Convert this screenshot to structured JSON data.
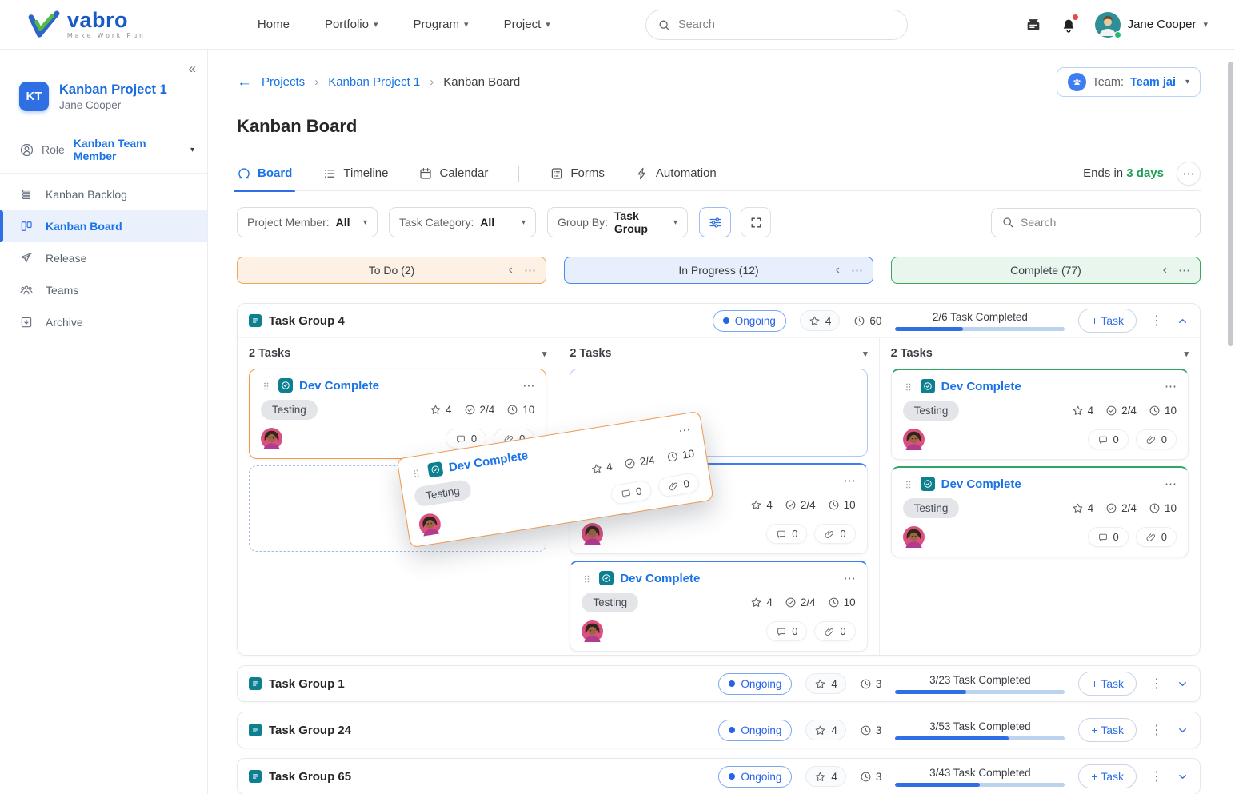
{
  "colors": {
    "primary_blue": "#2F6FE4",
    "link_blue": "#1A73E8",
    "success_green": "#1E9E57",
    "todo_accent": "#EDA85C",
    "inprogress_accent": "#4E86F0",
    "complete_accent": "#3BA55D",
    "notification_red": "#E5484D",
    "task_badge_teal": "#0C7F90"
  },
  "icons": {
    "collapse-sidebar": "«",
    "more-horizontal": "⋯",
    "more-vertical": "⋮",
    "collapse-column": "‹",
    "caret-down": "▾",
    "back-arrow": "←",
    "chevron-right": "›",
    "plus": "+"
  },
  "topbar": {
    "logo_text": "vabro",
    "logo_tagline": "Make Work Fun",
    "nav": [
      {
        "label": "Home"
      },
      {
        "label": "Portfolio"
      },
      {
        "label": "Program"
      },
      {
        "label": "Project"
      }
    ],
    "search_placeholder": "Search",
    "user_name": "Jane Cooper"
  },
  "sidebar": {
    "project": {
      "initials": "KT",
      "name": "Kanban Project 1",
      "owner": "Jane Cooper"
    },
    "role_label": "Role",
    "role_value": "Kanban Team Member",
    "items": [
      {
        "label": "Kanban Backlog"
      },
      {
        "label": "Kanban Board"
      },
      {
        "label": "Release"
      },
      {
        "label": "Teams"
      },
      {
        "label": "Archive"
      }
    ]
  },
  "breadcrumb": {
    "items": [
      {
        "label": "Projects"
      },
      {
        "label": "Kanban Project 1"
      },
      {
        "label": "Kanban Board"
      }
    ]
  },
  "team": {
    "label": "Team:",
    "value": "Team jai"
  },
  "page_title": "Kanban Board",
  "tabs": {
    "items": [
      {
        "label": "Board"
      },
      {
        "label": "Timeline"
      },
      {
        "label": "Calendar"
      },
      {
        "label": "Forms"
      },
      {
        "label": "Automation"
      }
    ],
    "ends_prefix": "Ends in ",
    "ends_value": "3 days"
  },
  "filters": {
    "items": [
      {
        "label": "Project Member: ",
        "value": "All"
      },
      {
        "label": "Task Category: ",
        "value": "All"
      },
      {
        "label": "Group By: ",
        "value": "Task Group"
      }
    ],
    "search_placeholder": "Search"
  },
  "board": {
    "columns": [
      {
        "title": "To Do (2)",
        "tasks_label": "2 Tasks"
      },
      {
        "title": "In Progress (12)",
        "tasks_label": "2 Tasks"
      },
      {
        "title": "Complete (77)",
        "tasks_label": "2 Tasks"
      }
    ],
    "group": {
      "name": "Task Group 4",
      "status": "Ongoing",
      "rating": "4",
      "time": "60",
      "progress_label": "2/6 Task Completed",
      "progress_pct": 40,
      "add_task_label": "+ Task"
    },
    "card": {
      "title": "Dev Complete",
      "tag": "Testing",
      "rating": "4",
      "checklist": "2/4",
      "time": "10",
      "comments": "0",
      "attachments": "0"
    },
    "groups": [
      {
        "name": "Task Group 1",
        "status": "Ongoing",
        "rating": "4",
        "time": "3",
        "progress_label": "3/23 Task Completed",
        "progress_pct": 42,
        "add_task_label": "+ Task"
      },
      {
        "name": "Task Group 24",
        "status": "Ongoing",
        "rating": "4",
        "time": "3",
        "progress_label": "3/53 Task Completed",
        "progress_pct": 67,
        "add_task_label": "+ Task"
      },
      {
        "name": "Task Group 65",
        "status": "Ongoing",
        "rating": "4",
        "time": "3",
        "progress_label": "3/43 Task Completed",
        "progress_pct": 50,
        "add_task_label": "+ Task"
      }
    ]
  }
}
